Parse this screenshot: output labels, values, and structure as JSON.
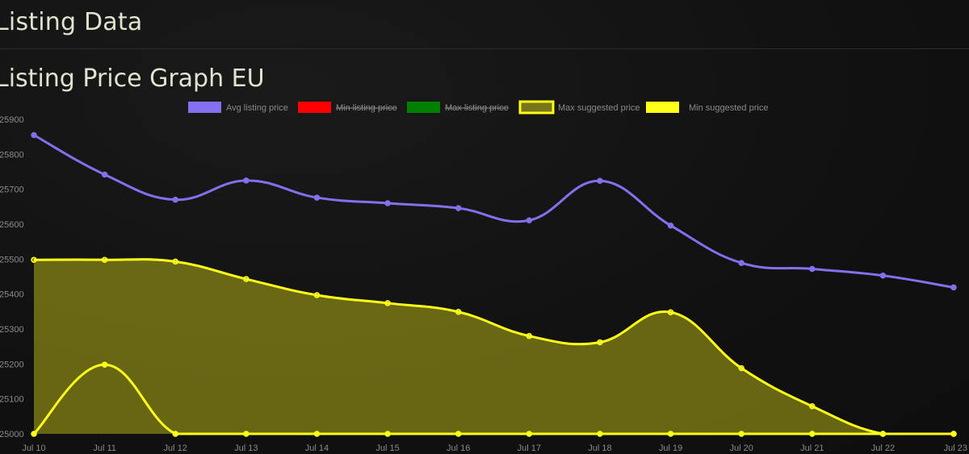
{
  "page": {
    "title": "Listing Data",
    "section_title": "Listing Price Graph EU"
  },
  "chart_data": {
    "type": "line",
    "title": "",
    "xlabel": "",
    "ylabel": "",
    "categories": [
      "Jul 10",
      "Jul 11",
      "Jul 12",
      "Jul 13",
      "Jul 14",
      "Jul 15",
      "Jul 16",
      "Jul 17",
      "Jul 18",
      "Jul 19",
      "Jul 20",
      "Jul 21",
      "Jul 22",
      "Jul 23"
    ],
    "ylim": [
      25000,
      25900
    ],
    "y_ticks": [
      "25900",
      "25800",
      "25700",
      "25600",
      "25500",
      "25400",
      "25300",
      "25200",
      "25100",
      "25000"
    ],
    "legend_position": "top-center",
    "grid": false,
    "series": [
      {
        "name": "Avg listing price",
        "color": "#8470ee",
        "hidden": false,
        "fill": false,
        "values": [
          25855,
          25742,
          25670,
          25725,
          25676,
          25660,
          25646,
          25611,
          25724,
          25596,
          25489,
          25472,
          25453,
          25419
        ]
      },
      {
        "name": "Min listing price",
        "color": "#ff0000",
        "hidden": true,
        "fill": false,
        "values": []
      },
      {
        "name": "Max listing price",
        "color": "#008000",
        "hidden": true,
        "fill": false,
        "values": []
      },
      {
        "name": "Max suggested price",
        "color": "#ffff1a",
        "hidden": false,
        "fill": true,
        "values": [
          25498,
          25498,
          25493,
          25443,
          25397,
          25374,
          25349,
          25280,
          25262,
          25348,
          25188,
          25079,
          25000,
          25000
        ]
      },
      {
        "name": "Min suggested price",
        "color": "#ffff1a",
        "hidden": false,
        "fill": false,
        "values": [
          25000,
          25198,
          25000,
          25000,
          25000,
          25000,
          25000,
          25000,
          25000,
          25000,
          25000,
          25000,
          25000,
          25000
        ]
      }
    ]
  }
}
